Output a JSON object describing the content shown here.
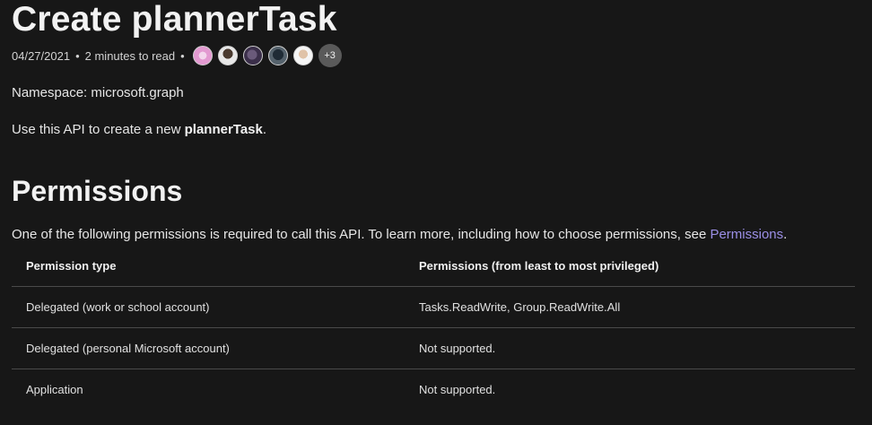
{
  "header": {
    "title": "Create plannerTask",
    "date": "04/27/2021",
    "separator": "•",
    "read_time": "2 minutes to read",
    "contributors_more": "+3"
  },
  "content": {
    "namespace": "Namespace: microsoft.graph",
    "intro_prefix": "Use this API to create a new ",
    "intro_bold": "plannerTask",
    "intro_suffix": "."
  },
  "permissions": {
    "heading": "Permissions",
    "description_prefix": "One of the following permissions is required to call this API. To learn more, including how to choose permissions, see ",
    "description_link": "Permissions",
    "description_suffix": ".",
    "table": {
      "headers": [
        "Permission type",
        "Permissions (from least to most privileged)"
      ],
      "rows": [
        [
          "Delegated (work or school account)",
          "Tasks.ReadWrite, Group.ReadWrite.All"
        ],
        [
          "Delegated (personal Microsoft account)",
          "Not supported."
        ],
        [
          "Application",
          "Not supported."
        ]
      ]
    }
  },
  "colors": {
    "background": "#171717",
    "text": "#e6e6e6",
    "link": "#9b8fe6",
    "divider": "#4a4a4a"
  }
}
